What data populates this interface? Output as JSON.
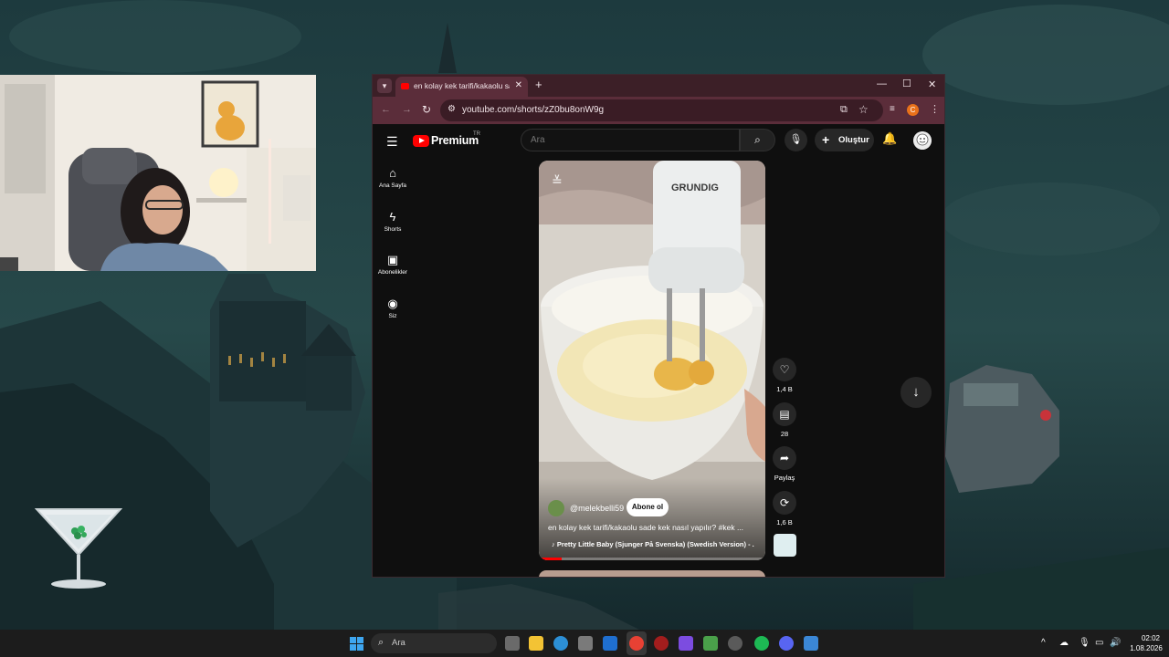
{
  "browser": {
    "tab_title": "en kolay kek tarifi/kakaolu sade kek nasıl yapılır?",
    "url": "youtube.com/shorts/zZ0bu8onW9g",
    "profile_initial": "C"
  },
  "youtube": {
    "logo_text": "Premium",
    "country_code": "TR",
    "search_placeholder": "Ara",
    "create_label": "Oluştur",
    "sidebar": [
      {
        "label": "Ana Sayfa",
        "icon": "home-icon"
      },
      {
        "label": "Shorts",
        "icon": "shorts-icon"
      },
      {
        "label": "Abonelikler",
        "icon": "subscriptions-icon"
      },
      {
        "label": "Siz",
        "icon": "you-icon"
      }
    ],
    "short": {
      "channel": "@melekbelli59",
      "subscribe_label": "Abone ol",
      "caption": "en kolay kek tarifi/kakaolu sade kek nasıl yapılır? #kek ...",
      "music": "Pretty Little Baby (Sjunger På Svenska) (Swedish Version) - ...",
      "video_brand": "GRUNDIG",
      "progress": 0.1
    },
    "actions": {
      "likes": "1,4 B",
      "comments": "28",
      "share": "Paylaş",
      "remix": "1,6 B"
    }
  },
  "taskbar": {
    "search_placeholder": "Ara",
    "time": "02:02",
    "date": "1.08.2026"
  }
}
